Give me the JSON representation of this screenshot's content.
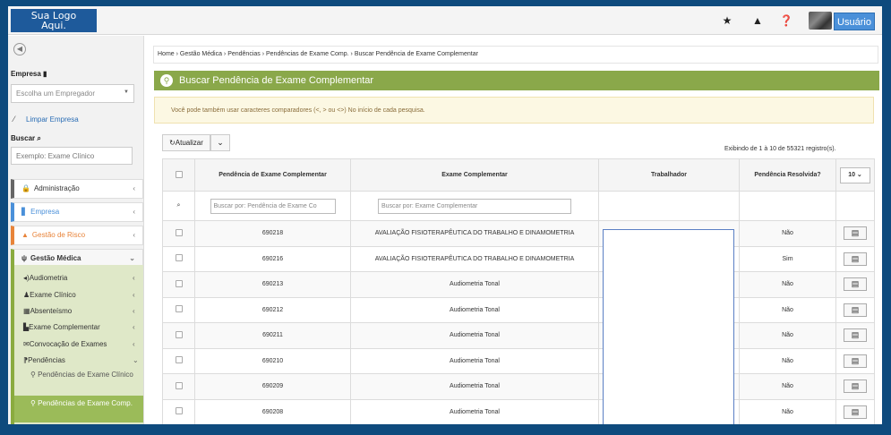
{
  "topbar": {
    "logo": "Sua Logo\nAqui.",
    "icons": [
      "star-icon",
      "warning-icon",
      "help-icon"
    ],
    "user_label": "Usuário"
  },
  "sidebar": {
    "empresa_label": "Empresa",
    "empresa_placeholder": "Escolha um Empregador",
    "clear_link": "Limpar Empresa",
    "search_label": "Buscar",
    "search_placeholder": "Exemplo: Exame Clínico",
    "menu": [
      {
        "label": "Administração",
        "color": "#666666"
      },
      {
        "label": "Empresa",
        "color": "#4a90d9"
      },
      {
        "label": "Gestão de Risco",
        "color": "#e8843a"
      },
      {
        "label": "Gestão Médica",
        "color": "#8aab3f"
      }
    ],
    "submenu": [
      {
        "label": "Audiometria"
      },
      {
        "label": "Exame Clínico"
      },
      {
        "label": "Absenteísmo"
      },
      {
        "label": "Exame Complementar"
      },
      {
        "label": "Convocação de Exames"
      },
      {
        "label": "Pendências"
      }
    ],
    "pend_sub1": "Pendências de Exame Clínico",
    "pend_sub2": "Pendências de Exame Comp."
  },
  "breadcrumb": "Home › Gestão Médica › Pendências › Pendências de Exame Comp. › Buscar Pendência de Exame Complementar",
  "panel_title": "Buscar Pendência de Exame Complementar",
  "info_text": "Você pode também usar caracteres comparadores (<, > ou <>) No início de cada pesquisa.",
  "toolbar": {
    "refresh_label": "Atualizar"
  },
  "showing_text": "Exibindo de 1 à 10 de 55321 registro(s).",
  "table": {
    "headers": [
      "Pendência de Exame Complementar",
      "Exame Complementar",
      "Trabalhador",
      "Pendência Resolvida?"
    ],
    "page_size": "10",
    "filter_placeholders": [
      "Buscar por: Pendência de Exame Co",
      "Buscar por: Exame Complementar"
    ],
    "rows": [
      {
        "id": "690218",
        "exam": "AVALIAÇÃO FISIOTERAPÊUTICA DO TRABALHO E DINAMOMETRIA",
        "resolved": "Não"
      },
      {
        "id": "690216",
        "exam": "AVALIAÇÃO FISIOTERAPÊUTICA DO TRABALHO E DINAMOMETRIA",
        "resolved": "Sim"
      },
      {
        "id": "690213",
        "exam": "Audiometria Tonal",
        "resolved": "Não"
      },
      {
        "id": "690212",
        "exam": "Audiometria Tonal",
        "resolved": "Não"
      },
      {
        "id": "690211",
        "exam": "Audiometria Tonal",
        "resolved": "Não"
      },
      {
        "id": "690210",
        "exam": "Audiometria Tonal",
        "resolved": "Não"
      },
      {
        "id": "690209",
        "exam": "Audiometria Tonal",
        "resolved": "Não"
      },
      {
        "id": "690208",
        "exam": "Audiometria Tonal",
        "resolved": "Não"
      }
    ]
  }
}
